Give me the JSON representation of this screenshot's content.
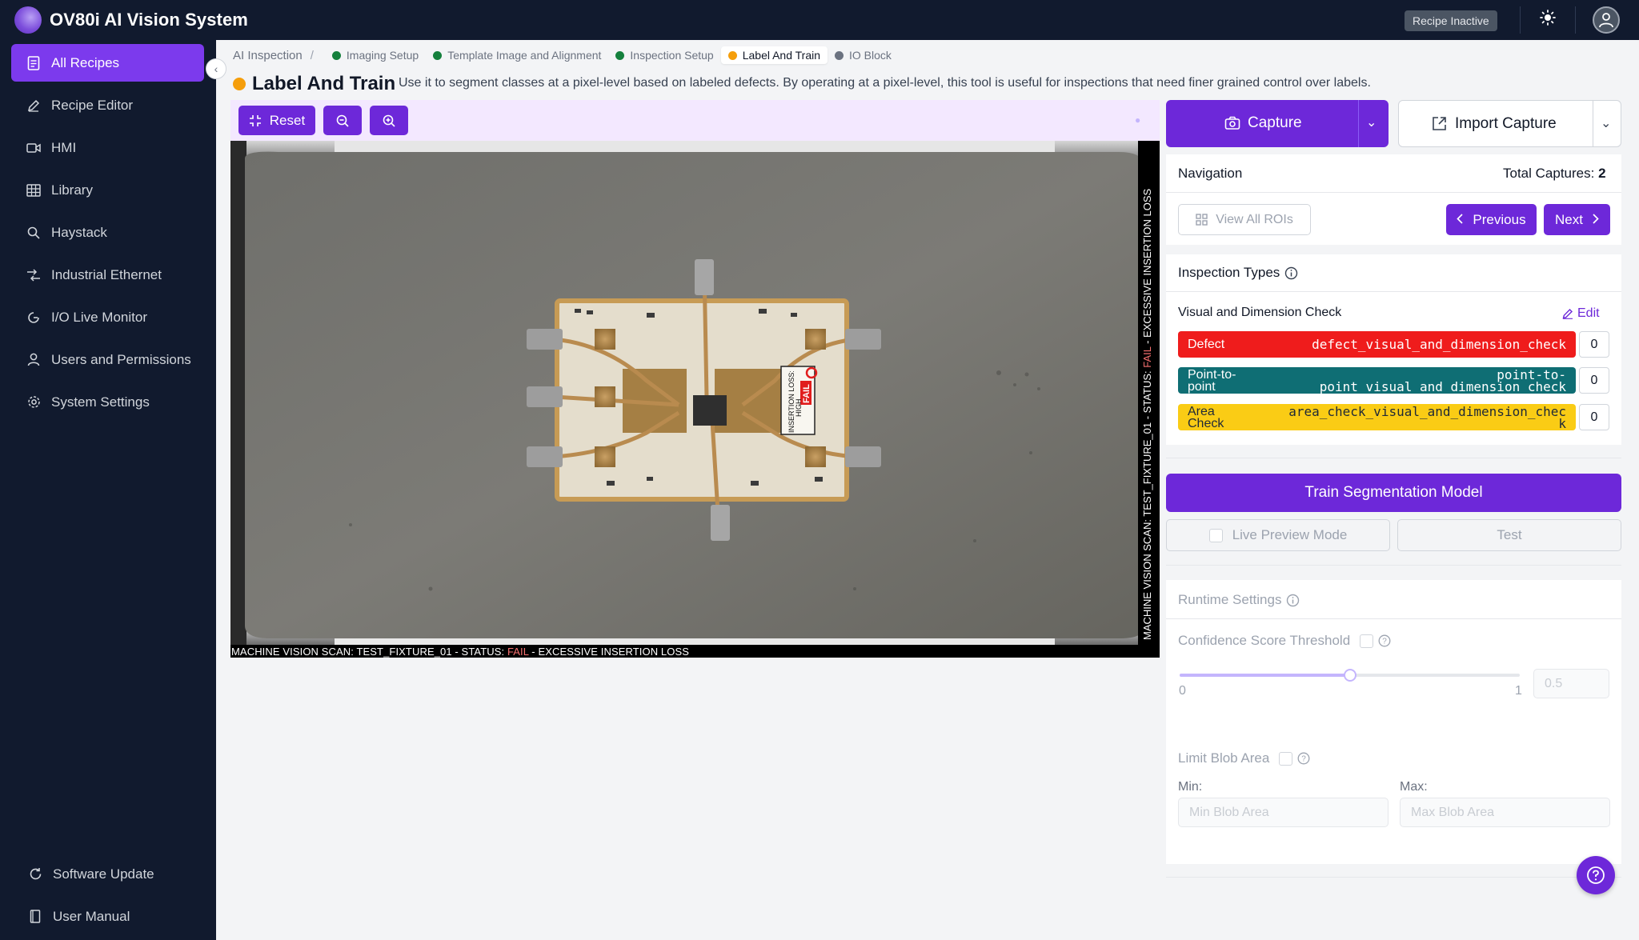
{
  "app": {
    "title": "OV80i AI Vision System",
    "recipe_status": "Recipe Inactive"
  },
  "sidebar": {
    "items": [
      {
        "label": "All Recipes",
        "icon": "document-icon",
        "active": true
      },
      {
        "label": "Recipe Editor",
        "icon": "pencil-icon"
      },
      {
        "label": "HMI",
        "icon": "video-icon"
      },
      {
        "label": "Library",
        "icon": "table-icon"
      },
      {
        "label": "Haystack",
        "icon": "search-icon"
      },
      {
        "label": "Industrial Ethernet",
        "icon": "network-icon"
      },
      {
        "label": "I/O Live Monitor",
        "icon": "gauge-icon"
      },
      {
        "label": "Users and Permissions",
        "icon": "user-icon"
      },
      {
        "label": "System Settings",
        "icon": "gear-icon"
      }
    ],
    "bottom": [
      {
        "label": "Software Update",
        "icon": "refresh-icon"
      },
      {
        "label": "User Manual",
        "icon": "book-icon"
      }
    ]
  },
  "breadcrumb": {
    "root": "AI Inspection",
    "separator": "/",
    "steps": [
      {
        "label": "Imaging Setup",
        "color": "#15803d"
      },
      {
        "label": "Template Image and Alignment",
        "color": "#15803d"
      },
      {
        "label": "Inspection Setup",
        "color": "#15803d"
      },
      {
        "label": "Label And Train",
        "color": "#f59e0b",
        "active": true
      },
      {
        "label": "IO Block",
        "color": "#6b7280"
      }
    ]
  },
  "page": {
    "title": "Label And Train",
    "description": "Use it to segment classes at a pixel-level based on labeled defects. By operating at a pixel-level, this tool is useful for inspections that need finer grained control over labels."
  },
  "toolbar": {
    "reset_label": "Reset"
  },
  "image": {
    "scan_text_prefix": "MACHINE VISION SCAN: TEST_FIXTURE_01 - STATUS: ",
    "scan_status": "FAIL",
    "scan_text_suffix": " - EXCESSIVE INSERTION LOSS",
    "board_tag_line1": "INSERTION LOSS:",
    "board_tag_line2": "HIGH",
    "board_tag_fail": "FAIL"
  },
  "capture": {
    "capture_label": "Capture",
    "import_label": "Import Capture"
  },
  "navigation": {
    "title": "Navigation",
    "total_label": "Total Captures: ",
    "total_value": "2",
    "view_all_label": "View All ROIs",
    "previous_label": "Previous",
    "next_label": "Next"
  },
  "inspection_types": {
    "title": "Inspection Types",
    "group_name": "Visual and Dimension Check",
    "edit_label": "Edit",
    "rows": [
      {
        "label": "Defect",
        "code": "defect_visual_and_dimension_check",
        "count": "0",
        "color": "#ef1c1c",
        "text_color": "#ffffff"
      },
      {
        "label": "Point-to-point",
        "code": "point_visual_and_dimension_check",
        "code_top": "point-to-",
        "count": "0",
        "color": "#0f6e74",
        "text_color": "#ffffff"
      },
      {
        "label": "Area Check",
        "code": "area_check_visual_and_dimension_chec",
        "code_tail": "k",
        "count": "0",
        "color": "#facc15",
        "text_color": "#1f2937"
      }
    ]
  },
  "training": {
    "train_label": "Train Segmentation Model",
    "live_preview_label": "Live Preview Mode",
    "test_label": "Test"
  },
  "runtime": {
    "title": "Runtime Settings",
    "confidence_label": "Confidence Score Threshold",
    "slider_min": "0",
    "slider_max": "1",
    "slider_value": 0.5,
    "slider_value_text": "0.5",
    "limit_blob_label": "Limit Blob Area",
    "min_label": "Min:",
    "max_label": "Max:",
    "min_placeholder": "Min Blob Area",
    "max_placeholder": "Max Blob Area"
  }
}
